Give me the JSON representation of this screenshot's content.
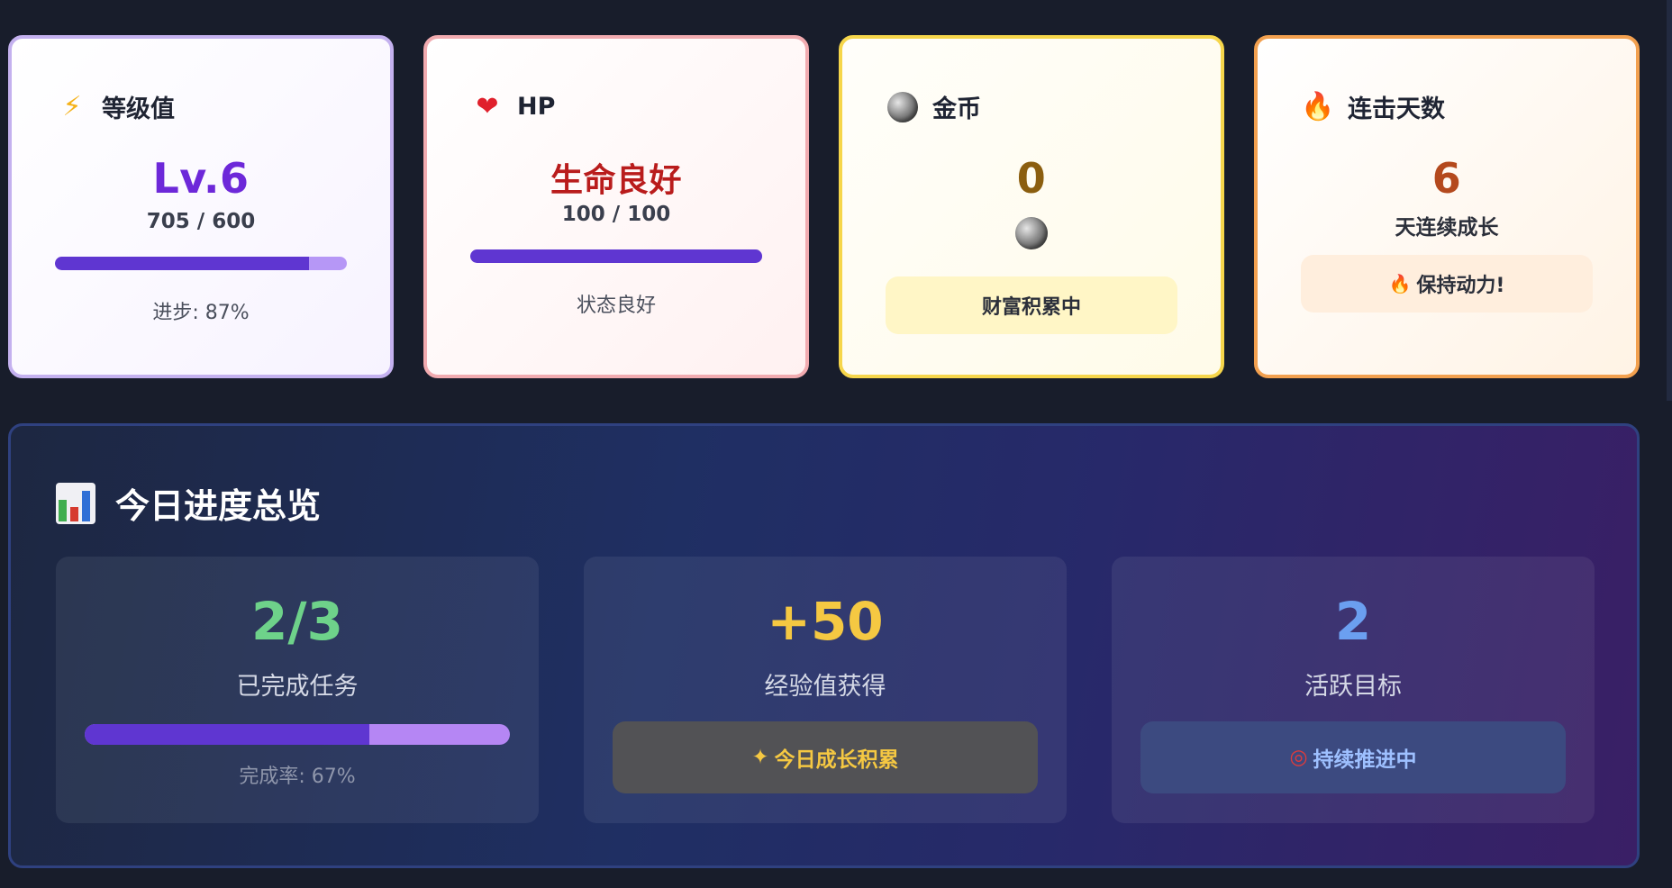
{
  "cards": {
    "level": {
      "icon": "lightning-icon",
      "title": "等级值",
      "value": "Lv.6",
      "detail": "705 / 600",
      "progress": 0.87,
      "footer": "进步: 87%",
      "value_color": "#6d28d9"
    },
    "hp": {
      "icon": "heart-icon",
      "title": "HP",
      "value": "生命良好",
      "detail": "100 / 100",
      "progress": 1.0,
      "footer": "状态良好",
      "value_color": "#b91c1c"
    },
    "coin": {
      "icon": "coin-icon",
      "title": "金币",
      "value": "0",
      "pill": "财富积累中",
      "value_color": "#8b5e0f",
      "pill_color": "#fff6c6"
    },
    "streak": {
      "icon": "fire-icon",
      "title": "连击天数",
      "value": "6",
      "detail": "天连续成长",
      "pill": "保持动力!",
      "value_color": "#b4491d",
      "pill_color": "#ffeedd"
    }
  },
  "overview": {
    "icon": "bar-chart-icon",
    "title": "今日进度总览",
    "tiles": [
      {
        "value": "2/3",
        "label": "已完成任务",
        "progress": 0.67,
        "footer": "完成率: 67%",
        "value_color": "#6ed28a"
      },
      {
        "value": "+50",
        "label": "经验值获得",
        "pill": "今日成长积累",
        "pill_icon": "sparkle-star-icon",
        "value_color": "#f5c842",
        "pill_bg": "#525255",
        "pill_color": "#f5c842"
      },
      {
        "value": "2",
        "label": "活跃目标",
        "pill": "持续推进中",
        "pill_icon": "target-icon",
        "value_color": "#6b9ff0",
        "pill_bg": "#3c4a80",
        "pill_color": "#9ec0ff"
      }
    ]
  }
}
